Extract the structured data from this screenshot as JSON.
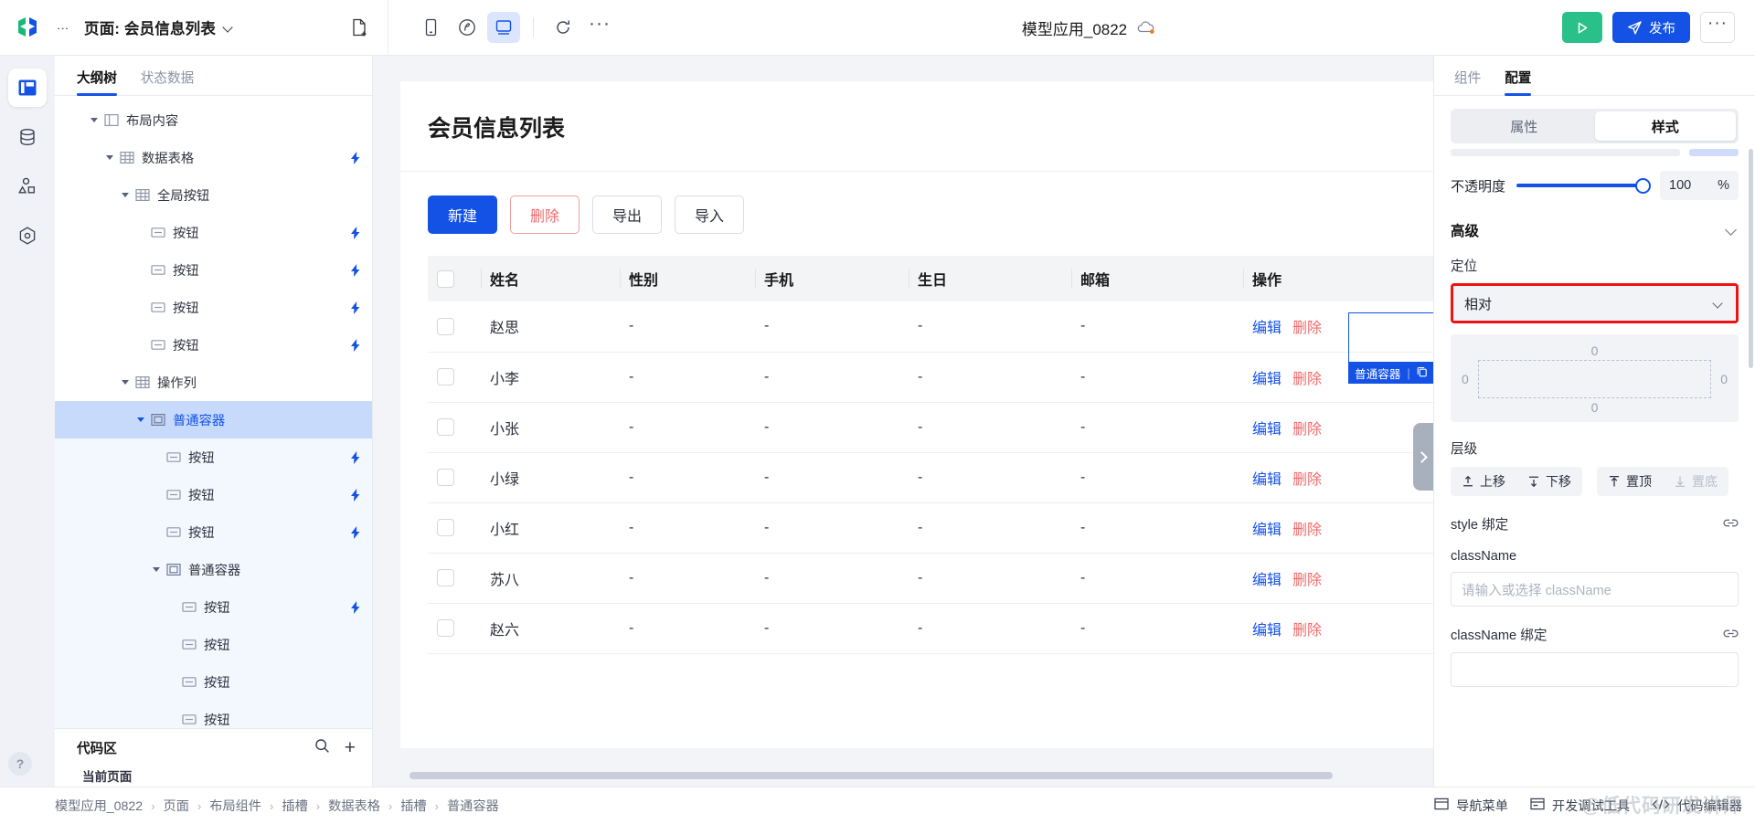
{
  "topbar": {
    "page_prefix": "页面: 会员信息列表",
    "new_page_icon": "new-file-icon",
    "tools": [
      {
        "name": "mobile-preview-icon",
        "label": "手机"
      },
      {
        "name": "tablet-preview-icon",
        "label": "平板"
      },
      {
        "name": "desktop-preview-icon",
        "label": "桌面",
        "active": true
      },
      {
        "name": "refresh-icon",
        "label": "刷新"
      }
    ],
    "more_tools_label": "···",
    "app_name": "模型应用_0822",
    "cloud_icon": "cloud-sync-icon",
    "run_label": "▶",
    "publish_label": "发布",
    "more_label": "···"
  },
  "rail": {
    "items": [
      {
        "name": "layout-icon",
        "active": true
      },
      {
        "name": "database-icon",
        "active": false
      },
      {
        "name": "shapes-icon",
        "active": false
      },
      {
        "name": "settings-hex-icon",
        "active": false
      }
    ],
    "help_label": "?"
  },
  "left_panel": {
    "tabs": [
      {
        "label": "大纲树",
        "active": true
      },
      {
        "label": "状态数据",
        "active": false
      }
    ],
    "tree": [
      {
        "label": "布局内容",
        "depth": 1,
        "caret": "open",
        "icon": "layout-node-icon",
        "bolt": false,
        "state": "normal"
      },
      {
        "label": "数据表格",
        "depth": 2,
        "caret": "open",
        "icon": "table-node-icon",
        "bolt": true,
        "state": "normal"
      },
      {
        "label": "全局按钮",
        "depth": 3,
        "caret": "open",
        "icon": "table-node-icon",
        "bolt": false,
        "state": "normal"
      },
      {
        "label": "按钮",
        "depth": 4,
        "caret": "none",
        "icon": "button-node-icon",
        "bolt": true,
        "state": "normal"
      },
      {
        "label": "按钮",
        "depth": 4,
        "caret": "none",
        "icon": "button-node-icon",
        "bolt": true,
        "state": "normal"
      },
      {
        "label": "按钮",
        "depth": 4,
        "caret": "none",
        "icon": "button-node-icon",
        "bolt": true,
        "state": "normal"
      },
      {
        "label": "按钮",
        "depth": 4,
        "caret": "none",
        "icon": "button-node-icon",
        "bolt": true,
        "state": "normal"
      },
      {
        "label": "操作列",
        "depth": 3,
        "caret": "open",
        "icon": "table-node-icon",
        "bolt": false,
        "state": "normal"
      },
      {
        "label": "普通容器",
        "depth": 4,
        "caret": "open",
        "icon": "container-node-icon",
        "bolt": false,
        "state": "selected"
      },
      {
        "label": "按钮",
        "depth": 5,
        "caret": "none",
        "icon": "button-node-icon",
        "bolt": true,
        "state": "branch"
      },
      {
        "label": "按钮",
        "depth": 5,
        "caret": "none",
        "icon": "button-node-icon",
        "bolt": true,
        "state": "branch"
      },
      {
        "label": "按钮",
        "depth": 5,
        "caret": "none",
        "icon": "button-node-icon",
        "bolt": true,
        "state": "branch"
      },
      {
        "label": "普通容器",
        "depth": 5,
        "caret": "open",
        "icon": "container-node-icon",
        "bolt": false,
        "state": "branch"
      },
      {
        "label": "按钮",
        "depth": 6,
        "caret": "none",
        "icon": "button-node-icon",
        "bolt": true,
        "state": "branch"
      },
      {
        "label": "按钮",
        "depth": 6,
        "caret": "none",
        "icon": "button-node-icon",
        "bolt": false,
        "state": "branch"
      },
      {
        "label": "按钮",
        "depth": 6,
        "caret": "none",
        "icon": "button-node-icon",
        "bolt": false,
        "state": "branch"
      },
      {
        "label": "按钮",
        "depth": 6,
        "caret": "none",
        "icon": "button-node-icon",
        "bolt": false,
        "state": "branch"
      }
    ],
    "code_area": {
      "title": "代码区",
      "search_icon": "search-icon",
      "add_icon": "plus-icon",
      "first_item": "当前页面"
    }
  },
  "canvas": {
    "page_title": "会员信息列表",
    "toolbar": [
      {
        "label": "新建",
        "style": "primary"
      },
      {
        "label": "删除",
        "style": "danger"
      },
      {
        "label": "导出",
        "style": "plain"
      },
      {
        "label": "导入",
        "style": "plain"
      }
    ],
    "table": {
      "columns": [
        "",
        "姓名",
        "性别",
        "手机",
        "生日",
        "邮箱",
        "操作"
      ],
      "rows": [
        {
          "name": "赵思",
          "gender": "-",
          "phone": "-",
          "birthday": "-",
          "email": "-"
        },
        {
          "name": "小李",
          "gender": "-",
          "phone": "-",
          "birthday": "-",
          "email": "-"
        },
        {
          "name": "小张",
          "gender": "-",
          "phone": "-",
          "birthday": "-",
          "email": "-"
        },
        {
          "name": "小绿",
          "gender": "-",
          "phone": "-",
          "birthday": "-",
          "email": "-"
        },
        {
          "name": "小红",
          "gender": "-",
          "phone": "-",
          "birthday": "-",
          "email": "-"
        },
        {
          "name": "苏八",
          "gender": "-",
          "phone": "-",
          "birthday": "-",
          "email": "-"
        },
        {
          "name": "赵六",
          "gender": "-",
          "phone": "-",
          "birthday": "-",
          "email": "-"
        }
      ],
      "op_edit": "编辑",
      "op_delete": "删除"
    },
    "selection_badge": "普通容器",
    "selection_color": "#1452e6"
  },
  "right_panel": {
    "tabs": [
      {
        "label": "组件",
        "active": false
      },
      {
        "label": "配置",
        "active": true
      }
    ],
    "segments": [
      {
        "label": "属性",
        "active": false
      },
      {
        "label": "样式",
        "active": true
      }
    ],
    "opacity": {
      "label": "不透明度",
      "value": "100",
      "unit": "%"
    },
    "advanced": {
      "title": "高级",
      "position_label": "定位",
      "position_value": "相对",
      "offsets": {
        "top": "0",
        "left": "0",
        "right": "0",
        "bottom": "0"
      },
      "highlight_color": "#ee1212"
    },
    "layer": {
      "label": "层级",
      "buttons": [
        {
          "label": "上移",
          "icon": "move-up-icon",
          "disabled": false
        },
        {
          "label": "下移",
          "icon": "move-down-icon",
          "disabled": false
        },
        {
          "label": "置顶",
          "icon": "to-top-icon",
          "disabled": false
        },
        {
          "label": "置底",
          "icon": "to-bottom-icon",
          "disabled": true
        }
      ]
    },
    "style_binding_label": "style 绑定",
    "class_name_label": "className",
    "class_name_placeholder": "请输入或选择 className",
    "class_name_binding_label": "className 绑定",
    "link_icon": "link-icon"
  },
  "bottom": {
    "breadcrumb": [
      "模型应用_0822",
      "页面",
      "布局组件",
      "插槽",
      "数据表格",
      "插槽",
      "普通容器"
    ],
    "separator": "›",
    "actions": [
      {
        "label": "导航菜单",
        "icon": "nav-menu-icon"
      },
      {
        "label": "开发调试工具",
        "icon": "debug-tool-icon"
      },
      {
        "label": "代码编辑器",
        "icon": "code-icon"
      }
    ],
    "watermark": "@低代码研发讲师"
  }
}
